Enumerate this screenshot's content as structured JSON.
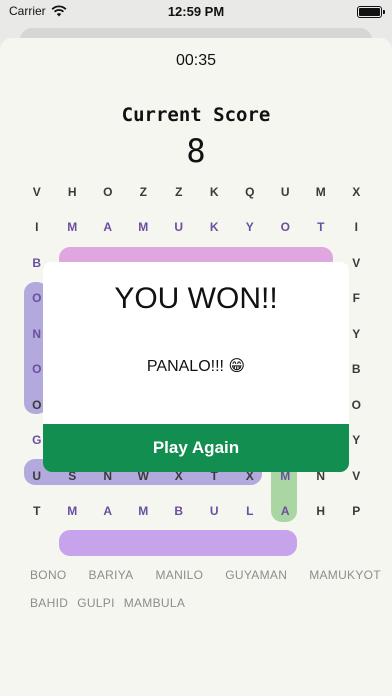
{
  "status": {
    "carrier": "Carrier",
    "time": "12:59 PM"
  },
  "timer": "00:35",
  "score": {
    "label": "Current Score",
    "value": "8"
  },
  "grid_rows": [
    [
      "V",
      "H",
      "O",
      "Z",
      "Z",
      "K",
      "Q",
      "U",
      "M",
      "X"
    ],
    [
      "I",
      "M",
      "A",
      "M",
      "U",
      "K",
      "Y",
      "O",
      "T",
      "I"
    ],
    [
      "B",
      "",
      "",
      "",
      "",
      "",
      "",
      "",
      "",
      "V"
    ],
    [
      "O",
      "",
      "",
      "",
      "",
      "",
      "",
      "",
      "",
      "F"
    ],
    [
      "N",
      "",
      "",
      "",
      "",
      "",
      "",
      "",
      "",
      "Y"
    ],
    [
      "O",
      "",
      "",
      "",
      "",
      "",
      "",
      "",
      "",
      "B"
    ],
    [
      "O",
      "",
      "",
      "",
      "",
      "",
      "",
      "",
      "",
      "O"
    ],
    [
      "G",
      "U",
      "Y",
      "A",
      "M",
      "A",
      "N",
      "A",
      "U",
      "Y"
    ],
    [
      "U",
      "S",
      "N",
      "W",
      "X",
      "T",
      "X",
      "M",
      "N",
      "V"
    ],
    [
      "T",
      "M",
      "A",
      "M",
      "B",
      "U",
      "L",
      "A",
      "H",
      "P"
    ]
  ],
  "words": {
    "row1": [
      "BONO",
      "BARIYA",
      "MANILO",
      "GUYAMAN",
      "MAMUKYOT"
    ],
    "row2": [
      "BAHID",
      "GULPI",
      "MAMBULA"
    ]
  },
  "modal": {
    "title": "YOU WON!!",
    "message": "PANALO!!! 😁",
    "button": "Play Again"
  }
}
